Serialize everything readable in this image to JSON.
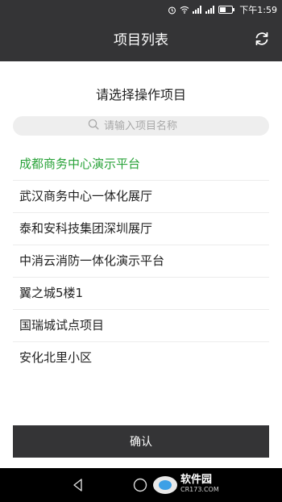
{
  "status_bar": {
    "time": "下午1:59",
    "icons": [
      "alarm-icon",
      "wifi-icon",
      "signal-icon",
      "signal-icon",
      "battery-icon"
    ]
  },
  "app_bar": {
    "title": "项目列表",
    "refresh_icon": "refresh-icon"
  },
  "prompt": "请选择操作项目",
  "search": {
    "placeholder": "请输入项目名称",
    "value": "",
    "icon": "search-icon"
  },
  "projects": [
    {
      "label": "成都商务中心演示平台",
      "selected": true
    },
    {
      "label": "武汉商务中心一体化展厅",
      "selected": false
    },
    {
      "label": "泰和安科技集团深圳展厅",
      "selected": false
    },
    {
      "label": "中消云消防一体化演示平台",
      "selected": false
    },
    {
      "label": "翼之城5楼1",
      "selected": false
    },
    {
      "label": "国瑞城试点项目",
      "selected": false
    },
    {
      "label": "安化北里小区",
      "selected": false
    }
  ],
  "confirm_label": "确认",
  "colors": {
    "bar": "#343436",
    "selected_text": "#2aa33a",
    "search_bg": "#eeeeee"
  },
  "watermark": {
    "name": "软件园",
    "url": "CR173.COM"
  }
}
